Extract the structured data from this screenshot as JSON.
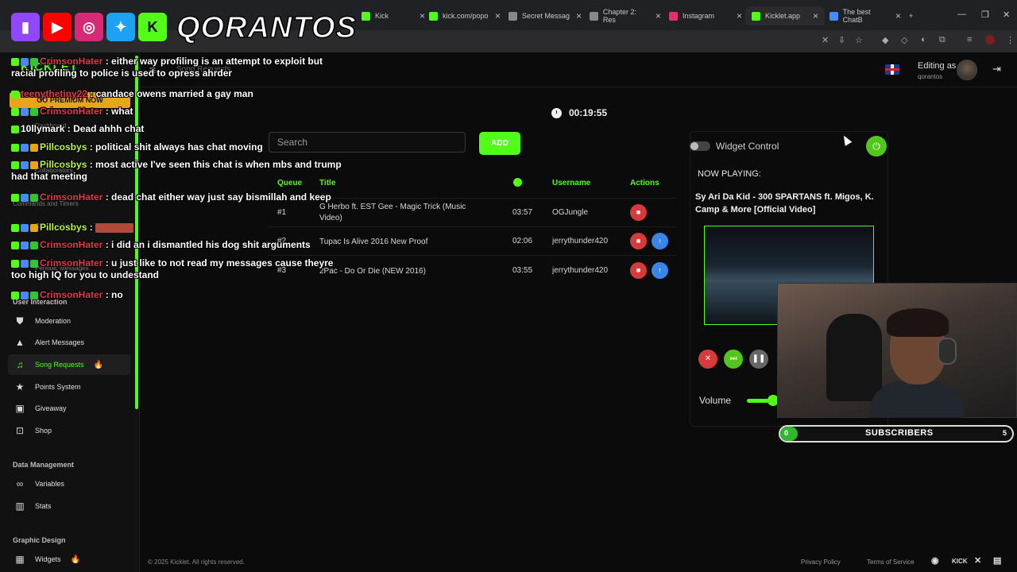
{
  "browser": {
    "tabs": [
      {
        "label": "Kick",
        "color": "#53fc18"
      },
      {
        "label": "kick.com/popo",
        "color": "#53fc18"
      },
      {
        "label": "Secret Messag",
        "color": "#888888"
      },
      {
        "label": "Chapter 2: Res",
        "color": "#888888"
      },
      {
        "label": "Instagram",
        "color": "#e1306c"
      },
      {
        "label": "Kicklet.app",
        "color": "#53fc18"
      },
      {
        "label": "The best ChatB",
        "color": "#4a8af4"
      }
    ]
  },
  "overlay": {
    "channel_name": "QORANTOS",
    "platform_letters": [
      "K"
    ],
    "chat": [
      {
        "user": "CrimsonHater",
        "user_color": "red",
        "text": ": either way profiling is an attempt to exploit but racial profiling to police is used to opress ahrder"
      },
      {
        "user": "teenythetiny22",
        "user_color": "red",
        "text": ": candace owens married a gay man"
      },
      {
        "user": "CrimsonHater",
        "user_color": "red",
        "text": ": what"
      },
      {
        "user": "10llymark",
        "user_color": "white",
        "text": ": Dead ahhh chat"
      },
      {
        "user": "Pillcosbys",
        "user_color": "green",
        "text": ": political shit always has chat moving"
      },
      {
        "user": "Pillcosbys",
        "user_color": "green",
        "text": ": most active I've seen this chat is when mbs and trump had that meeting"
      },
      {
        "user": "CrimsonHater",
        "user_color": "red",
        "text": ": dead chat either way just say bismillah and keep"
      },
      {
        "user": "Pillcosbys",
        "user_color": "green",
        "text": ":"
      },
      {
        "user": "CrimsonHater",
        "user_color": "red",
        "text": ": i did an i dismantled his dog shit arguments"
      },
      {
        "user": "CrimsonHater",
        "user_color": "red",
        "text": ": u just like to not read my messages cause theyre too high IQ for you to undestand"
      },
      {
        "user": "CrimsonHater",
        "user_color": "red",
        "text": ": no"
      }
    ]
  },
  "sidebar": {
    "logo": "KICKLET",
    "premium": "GO PREMIUM NOW",
    "faded_items": [
      "Dashboard",
      "Collaborators",
      "Commands and Timers",
      "Commands",
      "Periodic Messages"
    ],
    "section_user_interaction": "User Interaction",
    "items": [
      {
        "label": "Moderation",
        "icon": "shield-icon"
      },
      {
        "label": "Alert Messages",
        "icon": "warning-icon"
      },
      {
        "label": "Song Requests",
        "icon": "music-icon"
      },
      {
        "label": "Points System",
        "icon": "star-icon"
      },
      {
        "label": "Giveaway",
        "icon": "gift-icon"
      },
      {
        "label": "Shop",
        "icon": "cart-icon"
      }
    ],
    "section_data": "Data Management",
    "data_items": [
      {
        "label": "Variables",
        "icon": "link-icon"
      },
      {
        "label": "Stats",
        "icon": "stats-icon"
      }
    ],
    "section_graphic": "Graphic Design",
    "graphic_items": [
      {
        "label": "Widgets",
        "icon": "widgets-icon"
      }
    ]
  },
  "header": {
    "breadcrumb": "Song Requests",
    "editing_as": "Editing as",
    "username": "qorantos"
  },
  "timer": "00:19:55",
  "search": {
    "placeholder": "Search",
    "add_label": "ADD"
  },
  "queue": {
    "headers": {
      "queue": "Queue",
      "title": "Title",
      "username": "Username",
      "actions": "Actions"
    },
    "rows": [
      {
        "pos": "#1",
        "title": "G Herbo ft. EST Gee - Magic Trick (Music Video)",
        "duration": "03:57",
        "user": "OGJungle"
      },
      {
        "pos": "#2",
        "title": "Tupac Is Alive 2016 New Proof",
        "duration": "02:06",
        "user": "jerrythunder420"
      },
      {
        "pos": "#3",
        "title": "2Pac - Do Or Die (NEW 2016)",
        "duration": "03:55",
        "user": "jerrythunder420"
      }
    ]
  },
  "player": {
    "widget_control": "Widget Control",
    "now_playing_label": "NOW PLAYING:",
    "now_playing_title": "Sy Ari Da Kid - 300 SPARTANS ft. Migos, K. Camp & More [Official Video]",
    "volume_label": "Volume"
  },
  "subscribers": {
    "label": "SUBSCRIBERS",
    "current": "0",
    "goal": "5"
  },
  "footer": {
    "copyright": "© 2025 Kicklet. All rights reserved.",
    "privacy": "Privacy Policy",
    "terms": "Terms of Service",
    "kick_label": "KICK"
  }
}
